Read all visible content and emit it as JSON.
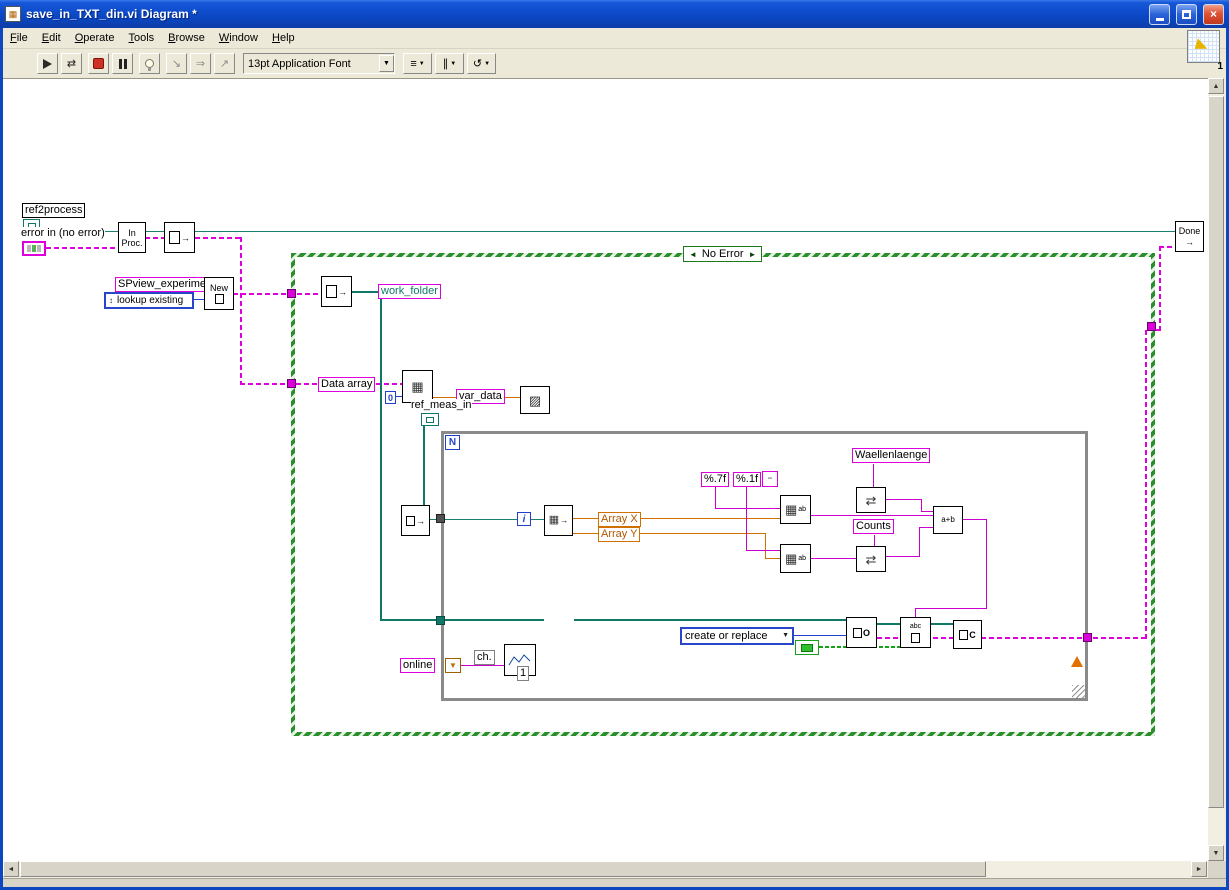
{
  "window": {
    "title": "save_in_TXT_din.vi Diagram *"
  },
  "menu": {
    "items": [
      "File",
      "Edit",
      "Operate",
      "Tools",
      "Browse",
      "Window",
      "Help"
    ]
  },
  "toolbar": {
    "font_selector": "13pt Application Font",
    "vi_icon_badge": "1"
  },
  "icons": {
    "scroll_up": "▲",
    "scroll_down": "▼",
    "scroll_left": "◄",
    "scroll_right": "►",
    "dropdown": "▼",
    "updown": "↕",
    "align": "≡",
    "distribute": "∥",
    "reorder": "↺",
    "step_into": "↘",
    "step_over": "⇒",
    "step_out": "↗",
    "run_continuous": "⇄",
    "case_prev": "◄",
    "case_next": "►",
    "ring_arrow": "▼",
    "grid": "▦",
    "grid_dense": "▩",
    "grid_diag": "▨",
    "swap": "⇄",
    "concat": "a+b",
    "arrow_right": "→",
    "small_cells": "▫▫",
    "window_glyph": "▦"
  },
  "diagram": {
    "labels": {
      "ref2process": "ref2process",
      "error_in": "error in (no error)",
      "in_proc": "In Proc.",
      "spview_experiment": "SPview_experiment",
      "lookup_existing": "lookup existing",
      "new_node": "New",
      "case_selector": "No Error",
      "work_folder": "work_folder",
      "data_array": "Data array",
      "zero": "0",
      "var_data": "var_data",
      "ref_meas_in": "ref_meas_in",
      "loop_count": "N",
      "loop_iteration": "i",
      "array_x": "Array X",
      "array_y": "Array Y",
      "format_a": "%.7f",
      "format_b": "%.1f",
      "waellenlaenge": "Waellenlaenge",
      "counts": "Counts",
      "create_or_replace": "create or replace",
      "online": "online",
      "channel": "ch.",
      "chart_number": "1",
      "write_abc": "abc",
      "close_c": "C",
      "open_o": "O",
      "done": "Done"
    },
    "colors": {
      "error_wire": "#dd00dd",
      "path_wire": "#117868",
      "numeric_wire": "#d07000",
      "string_wire": "#cc00cc",
      "boolean_wire": "#18a018",
      "integer_wire": "#2040cc",
      "case_border": "#2a8f2a"
    }
  }
}
